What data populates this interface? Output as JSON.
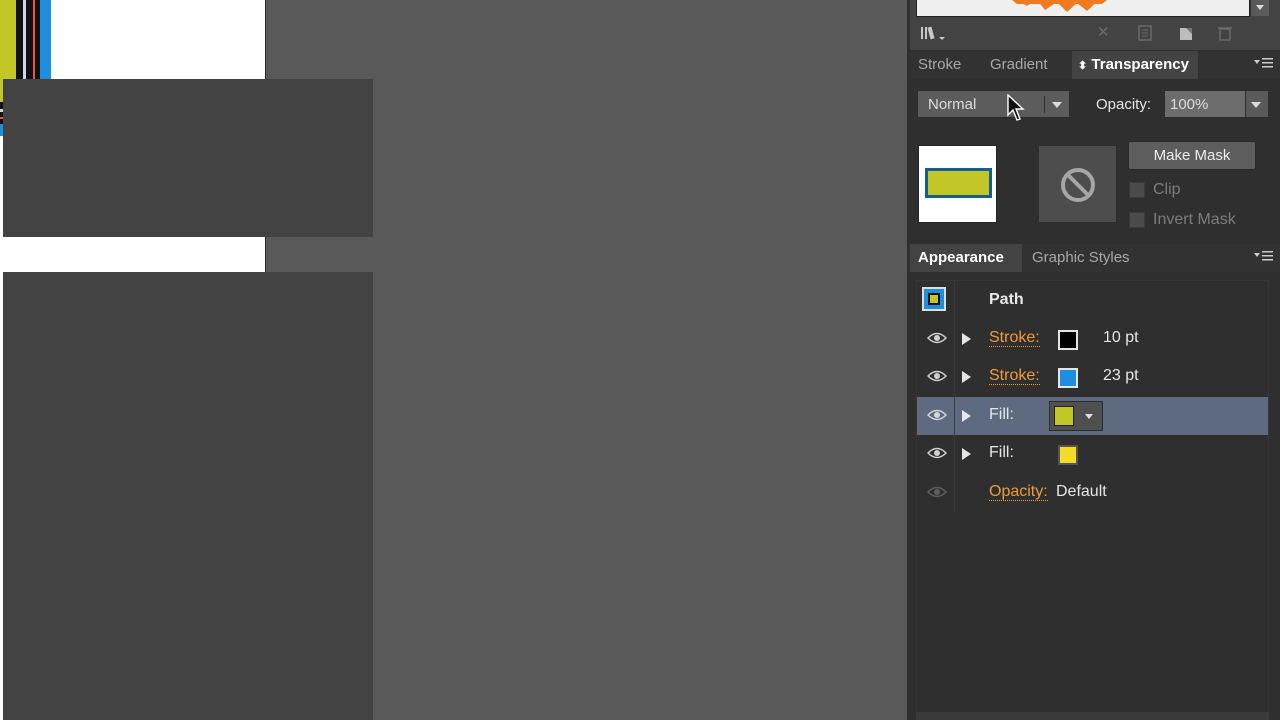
{
  "brush_panel": {
    "library_icon": "libraries-menu-icon",
    "tool_icons": [
      "remove-brush-icon",
      "options-icon",
      "new-brush-icon",
      "delete-icon"
    ]
  },
  "transparency_panel": {
    "tabs": [
      "Stroke",
      "Gradient",
      "Transparency"
    ],
    "active_tab": "Transparency",
    "blend_mode": "Normal",
    "opacity_label": "Opacity:",
    "opacity_value": "100%",
    "make_mask_label": "Make Mask",
    "clip_label": "Clip",
    "invert_mask_label": "Invert Mask",
    "clip_checked": false,
    "invert_mask_checked": false
  },
  "appearance_panel": {
    "tabs": [
      "Appearance",
      "Graphic Styles"
    ],
    "active_tab": "Appearance",
    "object_type": "Path",
    "rows": [
      {
        "kind": "Stroke:",
        "link": true,
        "color": "#000000",
        "value": "10 pt",
        "selected": false
      },
      {
        "kind": "Stroke:",
        "link": true,
        "color": "#1e8fe0",
        "value": "23 pt",
        "selected": false
      },
      {
        "kind": "Fill:",
        "link": false,
        "color": "#c2c627",
        "value": "",
        "selected": true
      },
      {
        "kind": "Fill:",
        "link": false,
        "color": "#f3dd26",
        "value": "",
        "selected": false
      }
    ],
    "opacity_row": {
      "label": "Opacity:",
      "value": "Default"
    }
  },
  "colors": {
    "accent_orange": "#ef9a3a",
    "selection": "#5d6a80",
    "artwork_blue": "#1e8fe0",
    "artwork_fill": "#c2c627"
  }
}
